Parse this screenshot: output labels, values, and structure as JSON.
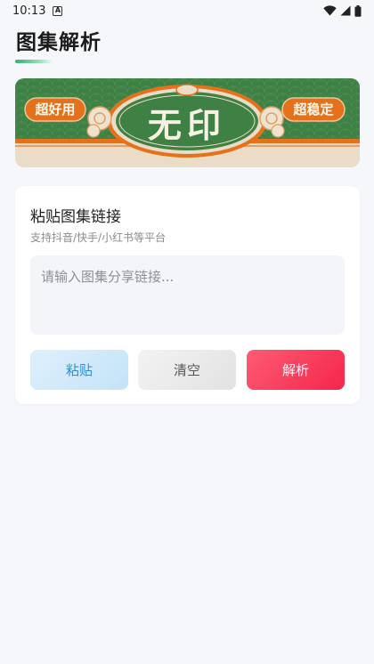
{
  "status_bar": {
    "time": "10:13",
    "notification_icon_label": "A",
    "icons": [
      "wifi-icon",
      "signal-icon",
      "battery-icon"
    ]
  },
  "header": {
    "title": "图集解析",
    "accent_color": "#35b073"
  },
  "banner": {
    "left_badge": "超好用",
    "center_text": "无印",
    "right_badge": "超稳定",
    "colors": {
      "green": "#3f8145",
      "orange": "#e4721c",
      "cream": "#eadcc6"
    }
  },
  "card": {
    "title": "粘贴图集链接",
    "subtitle": "支持抖音/快手/小红书等平台",
    "input": {
      "value": "",
      "placeholder": "请输入图集分享链接..."
    },
    "buttons": {
      "paste": "粘贴",
      "clear": "清空",
      "parse": "解析"
    },
    "colors": {
      "paste_text": "#2e8fd0",
      "parse_bg": "#f5264b"
    }
  }
}
